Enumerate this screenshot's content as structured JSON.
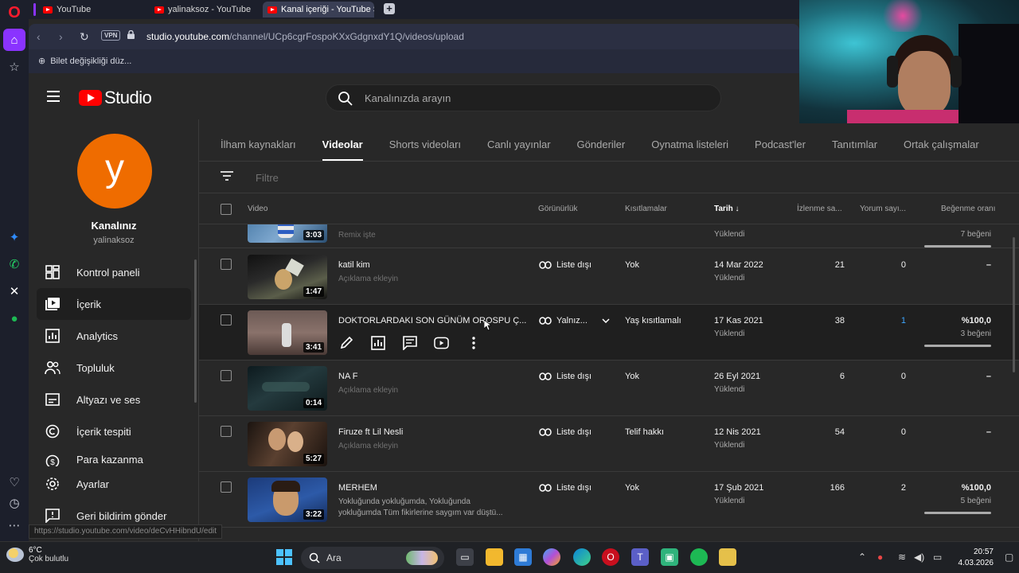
{
  "browser": {
    "tabs": [
      {
        "label": "YouTube"
      },
      {
        "label": "yalinaksoz - YouTube"
      },
      {
        "label": "Kanal içeriği - YouTube St"
      }
    ],
    "vpn_label": "VPN",
    "url_host": "studio.youtube.com",
    "url_path": "/channel/UCp6cgrFospoKXxGdgnxdY1Q/videos/upload",
    "bookmark": "Bilet değişikliği düz..."
  },
  "studio": {
    "logo_text": "Studio",
    "search_placeholder": "Kanalınızda arayın",
    "channel": {
      "initial": "y",
      "title": "Kanalınız",
      "handle": "yalinaksoz"
    },
    "menu": [
      {
        "label": "Kontrol paneli",
        "icon": "dashboard-icon"
      },
      {
        "label": "İçerik",
        "icon": "content-icon"
      },
      {
        "label": "Analytics",
        "icon": "analytics-icon"
      },
      {
        "label": "Topluluk",
        "icon": "community-icon"
      },
      {
        "label": "Altyazı ve ses",
        "icon": "subtitles-icon"
      },
      {
        "label": "İçerik tespiti",
        "icon": "copyright-icon"
      },
      {
        "label": "Para kazanma",
        "icon": "monetization-icon"
      }
    ],
    "bottom_menu": [
      {
        "label": "Ayarlar",
        "icon": "gear-icon"
      },
      {
        "label": "Geri bildirim gönder",
        "icon": "feedback-icon"
      }
    ],
    "tabs": [
      "İlham kaynakları",
      "Videolar",
      "Shorts videoları",
      "Canlı yayınlar",
      "Gönderiler",
      "Oynatma listeleri",
      "Podcast'ler",
      "Tanıtımlar",
      "Ortak çalışmalar"
    ],
    "filter_placeholder": "Filtre",
    "columns": {
      "video": "Video",
      "visibility": "Görünürlük",
      "restrictions": "Kısıtlamalar",
      "date": "Tarih",
      "views": "İzlenme sa...",
      "comments": "Yorum sayı...",
      "likes": "Beğenme oranı"
    },
    "rows": [
      {
        "duration": "3:03",
        "title": "",
        "desc": "Remix işte",
        "visibility": "",
        "restriction": "",
        "date": "",
        "state": "Yüklendi",
        "views": "",
        "comments": "",
        "likes": "",
        "likecount": "7 beğeni",
        "bar": true
      },
      {
        "duration": "1:47",
        "title": "katil kim",
        "desc": "Açıklama ekleyin",
        "visibility": "Liste dışı",
        "restriction": "Yok",
        "date": "14 Mar 2022",
        "state": "Yüklendi",
        "views": "21",
        "comments": "0",
        "likes": "–",
        "likecount": "",
        "bar": false
      },
      {
        "duration": "3:41",
        "title": "DOKTORLARDAKI SON GÜNÜM OROSPU Ç...",
        "desc": "",
        "visibility": "Yalnız...",
        "restriction": "Yaş kısıtlamalı",
        "date": "17 Kas 2021",
        "state": "Yüklendi",
        "views": "38",
        "comments": "1",
        "likes": "%100,0",
        "likecount": "3 beğeni",
        "bar": true
      },
      {
        "duration": "0:14",
        "title": "NA F",
        "desc": "Açıklama ekleyin",
        "visibility": "Liste dışı",
        "restriction": "Yok",
        "date": "26 Eyl 2021",
        "state": "Yüklendi",
        "views": "6",
        "comments": "0",
        "likes": "–",
        "likecount": "",
        "bar": false
      },
      {
        "duration": "5:27",
        "title": "Firuze ft Lil Nesli",
        "desc": "Açıklama ekleyin",
        "visibility": "Liste dışı",
        "restriction": "Telif hakkı",
        "date": "12 Nis 2021",
        "state": "Yüklendi",
        "views": "54",
        "comments": "0",
        "likes": "–",
        "likecount": "",
        "bar": false
      },
      {
        "duration": "3:22",
        "title": "MERHEM",
        "desc": "Yokluğunda yokluğumda, Yokluğunda yokluğumda Tüm fikirlerine saygım var düştü...",
        "visibility": "Liste dışı",
        "restriction": "Yok",
        "date": "17 Şub 2021",
        "state": "Yüklendi",
        "views": "166",
        "comments": "2",
        "likes": "%100,0",
        "likecount": "5 beğeni",
        "bar": true
      }
    ],
    "status_link": "https://studio.youtube.com/video/deCvHHibndU/edit"
  },
  "taskbar": {
    "weather_temp": "6°C",
    "weather_desc": "Çok bulutlu",
    "search_placeholder": "Ara",
    "time": "20:57",
    "date": "4.03.2026"
  },
  "colors": {
    "accent": "#ff0000",
    "avatar": "#ef6c00",
    "link": "#3ea6ff"
  }
}
